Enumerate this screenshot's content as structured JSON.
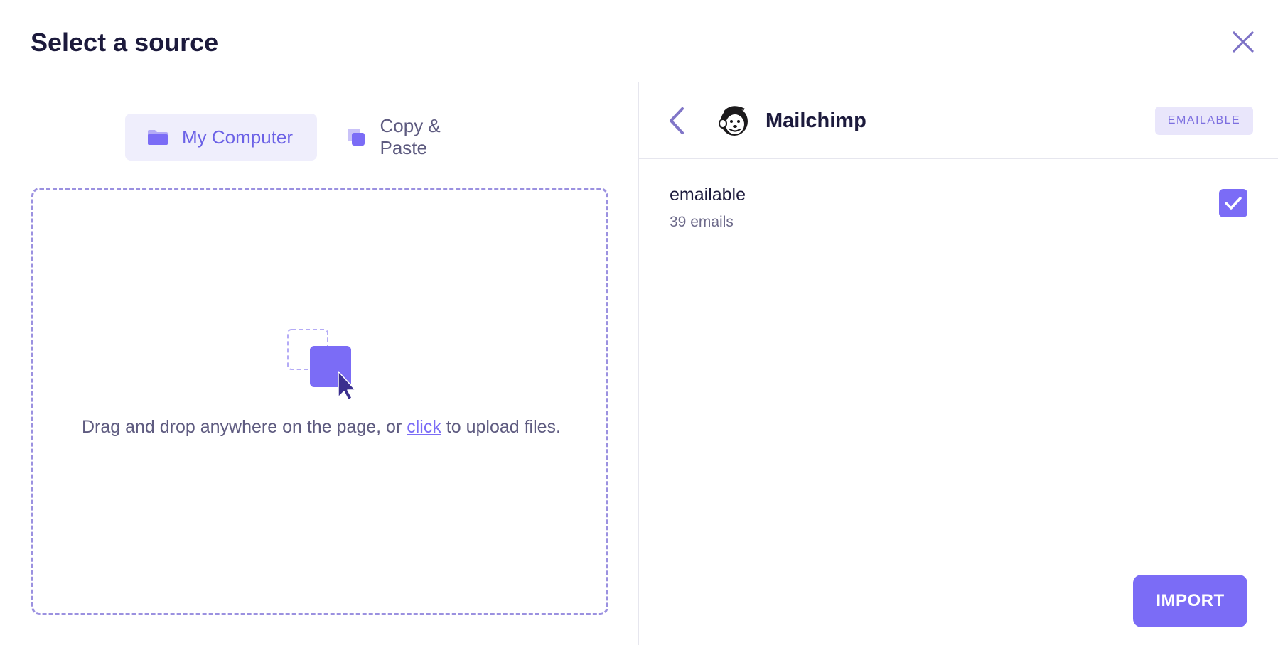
{
  "dialog": {
    "title": "Select a source",
    "close_icon": "close-icon"
  },
  "tabs": [
    {
      "label": "My Computer",
      "icon": "folder-icon",
      "active": true
    },
    {
      "label": "Copy & Paste",
      "icon": "copy-icon",
      "active": false
    }
  ],
  "dropzone": {
    "text_before": "Drag and drop anywhere on the page, or ",
    "link_text": "click",
    "text_after": " to upload files.",
    "icon": "upload-cursor-icon"
  },
  "source": {
    "name": "Mailchimp",
    "badge": "EMAILABLE",
    "logo_icon": "mailchimp-logo-icon",
    "back_icon": "chevron-left-icon"
  },
  "lists": [
    {
      "name": "emailable",
      "count": "39 emails",
      "checked": true
    }
  ],
  "footer": {
    "import_label": "IMPORT"
  },
  "colors": {
    "accent": "#7b6cf6",
    "heading": "#1c1a3c",
    "muted": "#5e5b80",
    "tab_active_bg": "#efeefc",
    "badge_bg": "#e9e6fb"
  }
}
